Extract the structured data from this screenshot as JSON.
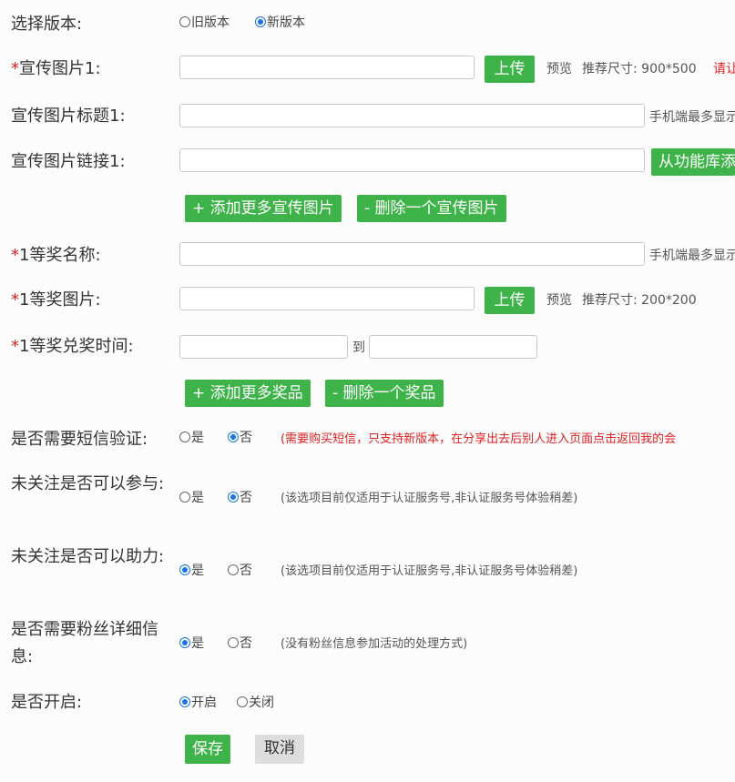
{
  "version": {
    "label": "选择版本:",
    "old": "旧版本",
    "new": "新版本"
  },
  "promo_image": {
    "required": "*",
    "label": "宣传图片1:",
    "upload": "上传",
    "preview": "预览",
    "size_hint": "推荐尺寸: 900*500",
    "warn": "请让"
  },
  "promo_title": {
    "label": "宣传图片标题1:",
    "hint": "手机端最多显示"
  },
  "promo_link": {
    "label": "宣传图片链接1:",
    "button": "从功能库添"
  },
  "promo_actions": {
    "add": "+ 添加更多宣传图片",
    "remove": "- 删除一个宣传图片"
  },
  "prize_name": {
    "required": "*",
    "label": "1等奖名称:",
    "hint": "手机端最多显示"
  },
  "prize_image": {
    "required": "*",
    "label": "1等奖图片:",
    "upload": "上传",
    "preview": "预览",
    "size_hint": "推荐尺寸: 200*200"
  },
  "prize_time": {
    "required": "*",
    "label": "1等奖兑奖时间:",
    "to": "到"
  },
  "prize_actions": {
    "add": "+ 添加更多奖品",
    "remove": "- 删除一个奖品"
  },
  "sms": {
    "label": "是否需要短信验证:",
    "yes": "是",
    "no": "否",
    "note": "(需要购买短信，只支持新版本，在分享出去后别人进入页面点击返回我的会"
  },
  "follow_join": {
    "label": "未关注是否可以参与:",
    "yes": "是",
    "no": "否",
    "note": "(该选项目前仅适用于认证服务号,非认证服务号体验稍差)"
  },
  "follow_help": {
    "label": "未关注是否可以助力:",
    "yes": "是",
    "no": "否",
    "note": "(该选项目前仅适用于认证服务号,非认证服务号体验稍差)"
  },
  "fans_info": {
    "label": "是否需要粉丝详细信息:",
    "yes": "是",
    "no": "否",
    "note": "(没有粉丝信息参加活动的处理方式)"
  },
  "enabled": {
    "label": "是否开启:",
    "on": "开启",
    "off": "关闭"
  },
  "footer": {
    "save": "保存",
    "cancel": "取消"
  }
}
